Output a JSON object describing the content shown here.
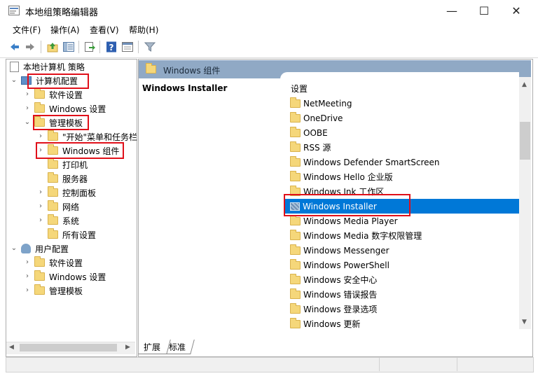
{
  "window": {
    "title": "本地组策略编辑器",
    "controls": {
      "minimize": "—",
      "maximize": "☐",
      "close": "✕"
    }
  },
  "menu": [
    "文件(F)",
    "操作(A)",
    "查看(V)",
    "帮助(H)"
  ],
  "toolbar_icons": [
    "back-icon",
    "forward-icon",
    "up-folder-icon",
    "show-hide-tree-icon",
    "export-list-icon",
    "help-icon",
    "properties-view-icon",
    "filter-icon"
  ],
  "tree": {
    "root": "本地计算机 策略",
    "computer_config": "计算机配置",
    "software_settings": "软件设置",
    "windows_settings": "Windows 设置",
    "admin_templates": "管理模板",
    "start_menu": "\"开始\"菜单和任务栏",
    "windows_components": "Windows 组件",
    "printers": "打印机",
    "servers": "服务器",
    "control_panel": "控制面板",
    "network": "网络",
    "system": "系统",
    "all_settings": "所有设置",
    "user_config": "用户配置",
    "user_software_settings": "软件设置",
    "user_windows_settings": "Windows 设置",
    "user_admin_templates": "管理模板"
  },
  "right_header": "Windows 组件",
  "description_title": "Windows Installer",
  "list": {
    "column_header": "设置",
    "items": [
      "NetMeeting",
      "OneDrive",
      "OOBE",
      "RSS 源",
      "Windows Defender SmartScreen",
      "Windows Hello 企业版",
      "Windows Ink 工作区",
      "Windows Installer",
      "Windows Media Player",
      "Windows Media 数字权限管理",
      "Windows Messenger",
      "Windows PowerShell",
      "Windows 安全中心",
      "Windows 错误报告",
      "Windows 登录选项",
      "Windows 更新"
    ],
    "selected_index": 7
  },
  "tabs": [
    "扩展",
    "标准"
  ],
  "colors": {
    "selection": "#0078d7",
    "header_bar": "#90a9c5",
    "highlight_box": "#e0101a"
  }
}
